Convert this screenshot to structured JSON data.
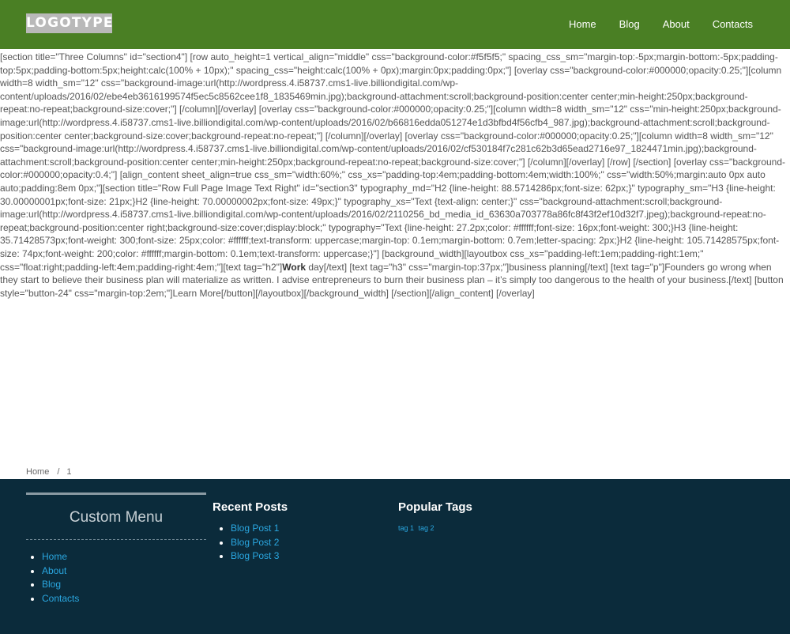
{
  "header": {
    "logo": "LOGOTYPE",
    "nav": [
      "Home",
      "Blog",
      "About",
      "Contacts"
    ]
  },
  "content": {
    "text_before": "[section title=\"Three Columns\" id=\"section4\"] [row auto_height=1 vertical_align=\"middle\" css=\"background-color:#f5f5f5;\" spacing_css_sm=\"margin-top:-5px;margin-bottom:-5px;padding-top:5px;padding-bottom:5px;height:calc(100% + 10px);\" spacing_css=\"height:calc(100% + 0px);margin:0px;padding:0px;\"] [overlay css=\"background-color:#000000;opacity:0.25;\"][column width=8 width_sm=\"12\" css=\"background-image:url(http://wordpress.4.i58737.cms1-live.billiondigital.com/wp-content/uploads/2016/02/ebe4eb3616199574f5ec5c8562cee1f8_1835469min.jpg);background-attachment:scroll;background-position:center center;min-height:250px;background-repeat:no-repeat;background-size:cover;\"] [/column][/overlay] [overlay css=\"background-color:#000000;opacity:0.25;\"][column width=8 width_sm=\"12\" css=\"min-height:250px;background-image:url(http://wordpress.4.i58737.cms1-live.billiondigital.com/wp-content/uploads/2016/02/b66816edda051274e1d3bfbd4f56cfb4_987.jpg);background-attachment:scroll;background-position:center center;background-size:cover;background-repeat:no-repeat;\"] [/column][/overlay] [overlay css=\"background-color:#000000;opacity:0.25;\"][column width=8 width_sm=\"12\" css=\"background-image:url(http://wordpress.4.i58737.cms1-live.billiondigital.com/wp-content/uploads/2016/02/cf530184f7c281c62b3d65ead2716e97_1824471min.jpg);background-attachment:scroll;background-position:center center;min-height:250px;background-repeat:no-repeat;background-size:cover;\"] [/column][/overlay] [/row] [/section] [overlay css=\"background-color:#000000;opacity:0.4;\"] [align_content sheet_align=true css_sm=\"width:60%;\" css_xs=\"padding-top:4em;padding-bottom:4em;width:100%;\" css=\"width:50%;margin:auto 0px auto auto;padding:8em 0px;\"][section title=\"Row Full Page Image Text Right\" id=\"section3\" typography_md=\"H2 {line-height: 88.5714286px;font-size: 62px;}\" typography_sm=\"H3 {line-height: 30.00000001px;font-size: 21px;}H2 {line-height: 70.00000002px;font-size: 49px;}\" typography_xs=\"Text {text-align: center;}\" css=\"background-attachment:scroll;background-image:url(http://wordpress.4.i58737.cms1-live.billiondigital.com/wp-content/uploads/2016/02/2110256_bd_media_id_63630a703778a86fc8f43f2ef10d32f7.jpeg);background-repeat:no-repeat;background-position:center right;background-size:cover;display:block;\" typography=\"Text {line-height: 27.2px;color: #ffffff;font-size: 16px;font-weight: 300;}H3 {line-height: 35.71428573px;font-weight: 300;font-size: 25px;color: #ffffff;text-transform: uppercase;margin-top: 0.1em;margin-bottom: 0.7em;letter-spacing: 2px;}H2 {line-height: 105.71428575px;font-size: 74px;font-weight: 200;color: #ffffff;margin-bottom: 0.1em;text-transform: uppercase;}\"] [background_width][layoutbox css_xs=\"padding-left:1em;padding-right:1em;\" css=\"float:right;padding-left:4em;padding-right:4em;\"][text tag=\"h2\"]",
    "bold_word": "Work",
    "text_after": " day[/text] [text tag=\"h3\" css=\"margin-top:37px;\"]business planning[/text] [text tag=\"p\"]Founders go wrong when they start to believe their business plan will materialize as written. I advise entrepreneurs to burn their business plan – it’s simply too dangerous to the health of your business.[/text] [button style=\"button-24\" css=\"margin-top:2em;\"]Learn More[/button][/layoutbox][/background_width] [/section][/align_content] [/overlay]"
  },
  "breadcrumb": {
    "home": "Home",
    "separator": "/",
    "current": "1"
  },
  "footer": {
    "custom_menu": {
      "title": "Custom Menu",
      "items": [
        "Home",
        "About",
        "Blog",
        "Contacts"
      ]
    },
    "recent_posts": {
      "title": "Recent Posts",
      "items": [
        "Blog Post 1",
        "Blog Post 2",
        "Blog Post 3"
      ]
    },
    "popular_tags": {
      "title": "Popular Tags",
      "tags": [
        "tag 1",
        "tag 2"
      ]
    }
  },
  "colors": {
    "header_bg": "#4a7f24",
    "footer_bg": "#0b2b3b",
    "link": "#2aa7e0"
  }
}
